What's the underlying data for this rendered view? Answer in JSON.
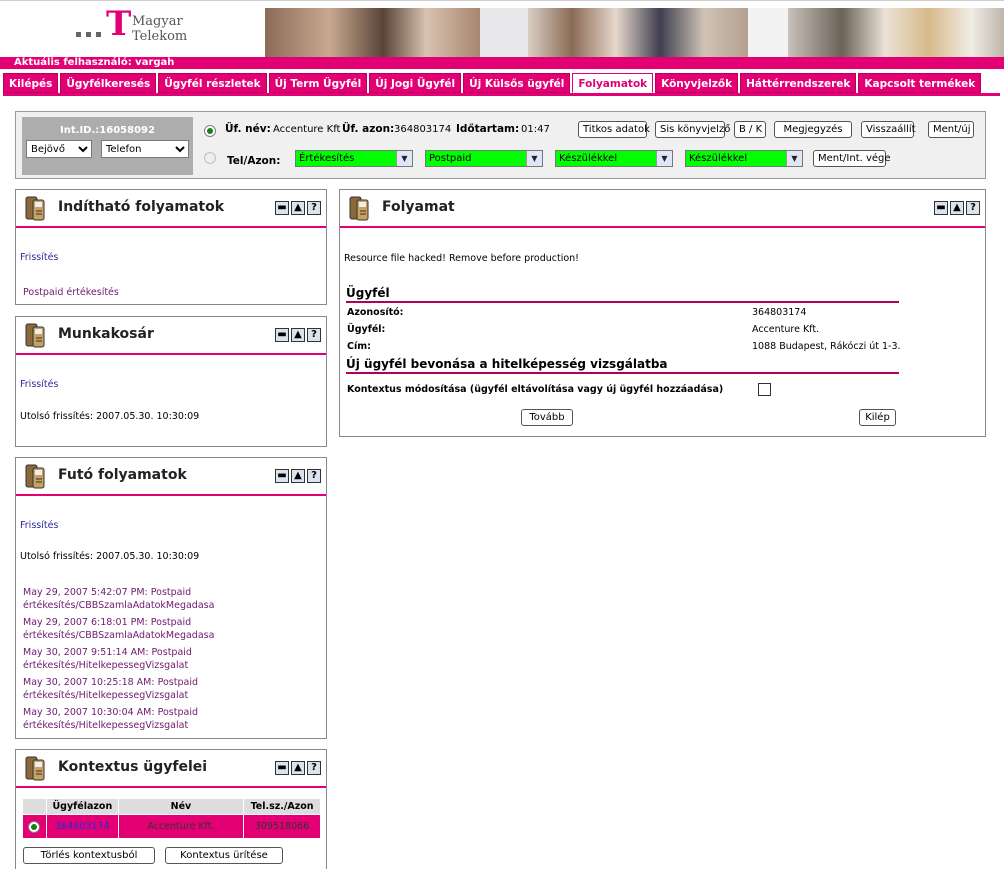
{
  "header": {
    "logo_line1": "Magyar",
    "logo_line2": "Telekom",
    "user_label": "Aktuális felhasználó: vargah"
  },
  "tabs": [
    {
      "label": "Kilépés"
    },
    {
      "label": "Ügyfélkeresés"
    },
    {
      "label": "Ügyfél részletek"
    },
    {
      "label": "Új Term Ügyfél"
    },
    {
      "label": "Új Jogi Ügyfél"
    },
    {
      "label": "Új Külsős ügyfél"
    },
    {
      "label": "Folyamatok",
      "active": true
    },
    {
      "label": "Könyvjelzők"
    },
    {
      "label": "Háttérrendszerek"
    },
    {
      "label": "Kapcsolt termékek"
    }
  ],
  "toolbar": {
    "int_id": "Int.ID.:16058092",
    "direction_value": "Bejövő",
    "channel_value": "Telefon",
    "uf_nev_label": "Üf. név:",
    "uf_nev_value": "Accenture Kft",
    "uf_azon_label": "Üf. azon:",
    "uf_azon_value": "364803174",
    "idotartam_label": "Időtartam:",
    "idotartam_value": "01:47",
    "tel_azon_label": "Tel/Azon:",
    "buttons": {
      "titkos": "Titkos adatok",
      "sis": "Sis könyvjelző",
      "bk": "B / K",
      "megjegyzes": "Megjegyzés",
      "visszaallit": "Visszaállít",
      "mentuj": "Ment/új",
      "mentint": "Ment/Int. vége"
    },
    "combos": [
      "Értékesítés",
      "Postpaid",
      "Készülékkel",
      "Készülékkel"
    ]
  },
  "panel_inditható": {
    "title": "Indítható folyamatok",
    "refresh": "Frissítés",
    "item": "Postpaid értékesítés"
  },
  "panel_munkakosar": {
    "title": "Munkakosár",
    "refresh": "Frissítés",
    "last_refresh": "Utolsó frissítés: 2007.05.30. 10:30:09"
  },
  "panel_futo": {
    "title": "Futó folyamatok",
    "refresh": "Frissítés",
    "last_refresh": "Utolsó frissítés: 2007.05.30. 10:30:09",
    "items": [
      {
        "l1": "May 29, 2007 5:42:07 PM: Postpaid",
        "l2": "értékesítés/CBBSzamlaAdatokMegadasa"
      },
      {
        "l1": "May 29, 2007 6:18:01 PM: Postpaid",
        "l2": "értékesítés/CBBSzamlaAdatokMegadasa"
      },
      {
        "l1": "May 30, 2007 9:51:14 AM: Postpaid",
        "l2": "értékesítés/HitelkepessegVizsgalat"
      },
      {
        "l1": "May 30, 2007 10:25:18 AM: Postpaid",
        "l2": "értékesítés/HitelkepessegVizsgalat"
      },
      {
        "l1": "May 30, 2007 10:30:04 AM: Postpaid",
        "l2": "értékesítés/HitelkepessegVizsgalat"
      }
    ]
  },
  "panel_kontextus": {
    "title": "Kontextus ügyfelei",
    "col_id": "Ügyfélazon",
    "col_name": "Név",
    "col_tel": "Tel.sz./Azon",
    "row_id": "364803174",
    "row_name": "Accenture Kft.",
    "row_tel": "309518066",
    "btn_torles": "Törlés kontextusból",
    "btn_urites": "Kontextus ürítése"
  },
  "panel_folyamat": {
    "title": "Folyamat",
    "notice": "Resource file hacked! Remove before production!",
    "section1": "Ügyfél",
    "azon_label": "Azonosító:",
    "azon_value": "364803174",
    "ugyfel_label": "Ügyfél:",
    "ugyfel_value": "Accenture Kft.",
    "cim_label": "Cím:",
    "cim_value": "1088 Budapest, Rákóczi út 1-3.",
    "section2": "Új ügyfél bevonása a hitelképesség vizsgálatba",
    "kontextus_label": "Kontextus módosítása (ügyfél eltávolítása vagy új ügyfél hozzáadása)",
    "btn_tovabb": "Tovább",
    "btn_kilep": "Kilép"
  },
  "colors": {
    "accent": "#e20074",
    "green": "#00ff00"
  }
}
